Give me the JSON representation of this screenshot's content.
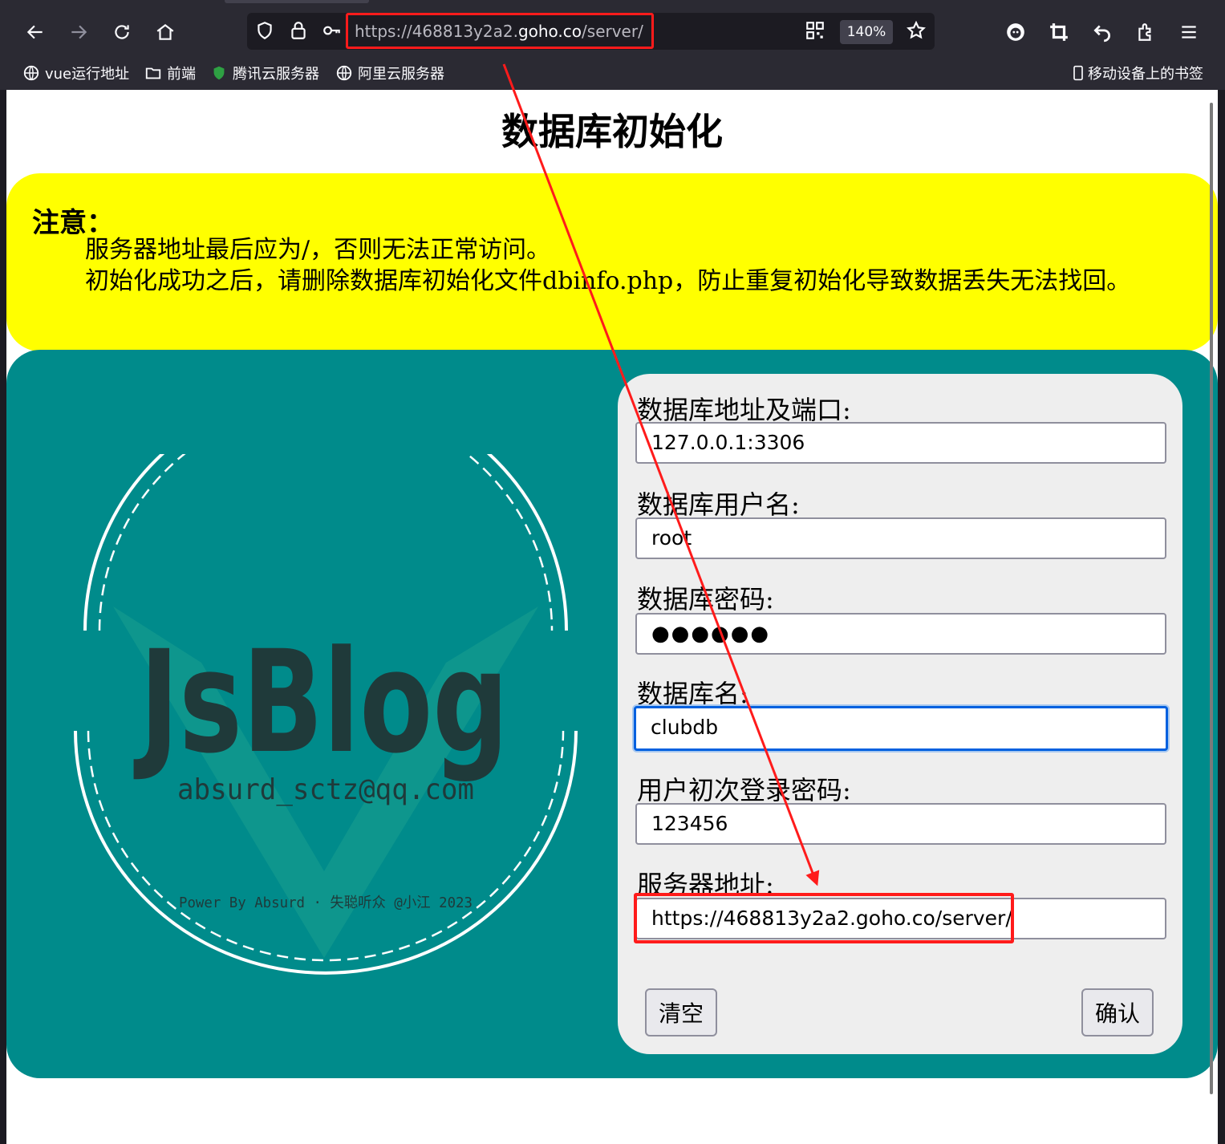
{
  "browser": {
    "url_prefix": "https://468813y2a2.",
    "url_domain": "goho.co",
    "url_path": "/server/",
    "zoom": "140%"
  },
  "bookmarks": [
    {
      "label": "vue运行地址",
      "icon": "globe-icon"
    },
    {
      "label": "前端",
      "icon": "folder-icon"
    },
    {
      "label": "腾讯云服务器",
      "icon": "shield-icon"
    },
    {
      "label": "阿里云服务器",
      "icon": "globe-icon"
    }
  ],
  "mobile_bookmarks": "移动设备上的书签",
  "page": {
    "title": "数据库初始化",
    "notice": {
      "title": "注意：",
      "line1": "服务器地址最后应为/，否则无法正常访问。",
      "line2": "初始化成功之后，请删除数据库初始化文件dbinfo.php，防止重复初始化导致数据丢失无法找回。"
    },
    "logo": {
      "title": "JsBlog",
      "email": "absurd_sctz@qq.com",
      "credit": "Power By Absurd · 失聪听众 @小江 2023"
    },
    "form": {
      "host_label": "数据库地址及端口:",
      "host_value": "127.0.0.1:3306",
      "user_label": "数据库用户名:",
      "user_value": "root",
      "password_label": "数据库密码:",
      "password_mask": "●●●●●●",
      "dbname_label": "数据库名:",
      "dbname_value": "clubdb",
      "init_password_label": "用户初次登录密码:",
      "init_password_value": "123456",
      "server_label": "服务器地址:",
      "server_value": "https://468813y2a2.goho.co/server/",
      "clear_button": "清空",
      "confirm_button": "确认"
    }
  },
  "colors": {
    "notice_bg": "#ffff00",
    "panel_bg": "#008b8b",
    "annotation": "#ff1b1b"
  }
}
